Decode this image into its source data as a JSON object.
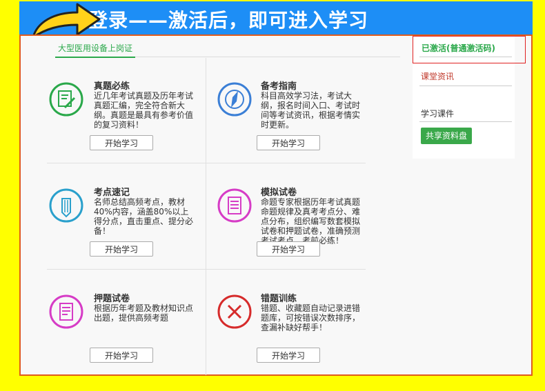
{
  "banner": {
    "title": "登录——激活后，即可进入学习"
  },
  "course_tab": "大型医用设备上岗证",
  "cards": [
    {
      "title": "真题必练",
      "desc": "近几年考试真题及历年考试真题汇编，完全符合新大纲。真题是最具有参考价值的复习资料！",
      "button": "开始学习"
    },
    {
      "title": "备考指南",
      "desc": "科目高效学习法，考试大纲，报名时间入口、考试时间等考试资讯，根据考情实时更新。",
      "button": "开始学习"
    },
    {
      "title": "考点速记",
      "desc": "名师总结高频考点，教材40%内容，涵盖80%以上得分点，直击重点、提分必备！",
      "button": "开始学习"
    },
    {
      "title": "模拟试卷",
      "desc": "命题专家根据历年考试真题命题规律及真考考点分、难点分布，组织编写数套模拟试卷和押题试卷，准确预测考试考点，考前必练！",
      "button": "开始学习"
    },
    {
      "title": "押题试卷",
      "desc": "根据历年考题及教材知识点出题，提供高频考题",
      "button": "开始学习"
    },
    {
      "title": "错题训练",
      "desc": "错题、收藏题自动记录进错题库，可按错误次数排序，查漏补缺好帮手！",
      "button": "开始学习"
    }
  ],
  "sidebar": {
    "activated": "已激活(普通激活码)",
    "news": "课堂资讯",
    "course": "学习课件",
    "share_button": "共享资料盘"
  }
}
